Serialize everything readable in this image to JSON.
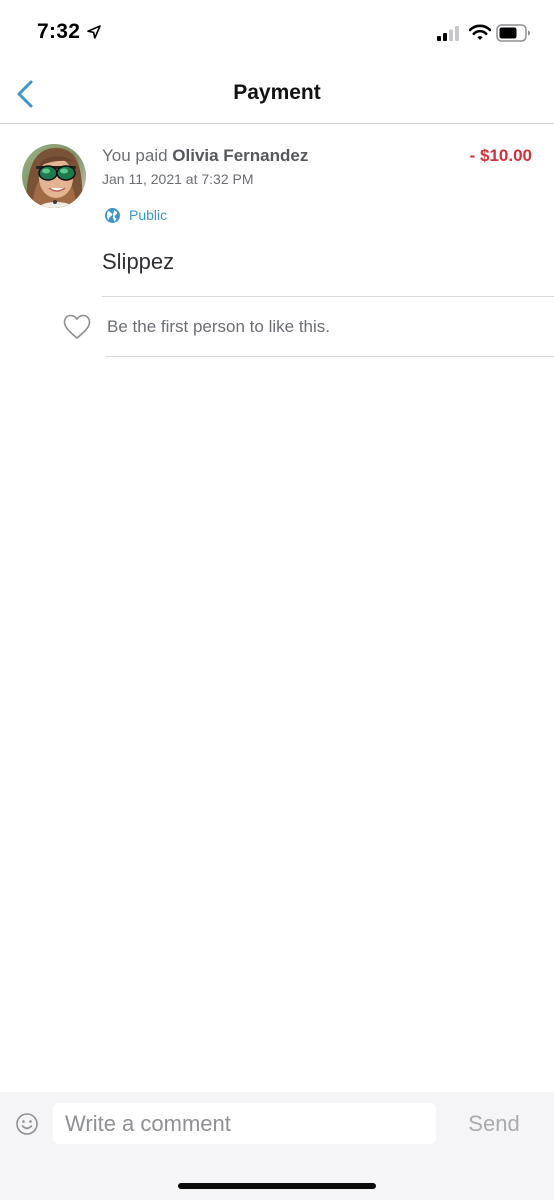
{
  "status_bar": {
    "time": "7:32",
    "icons": [
      "location-arrow-icon",
      "cellular-signal-icon",
      "wifi-icon",
      "battery-icon"
    ]
  },
  "nav": {
    "title": "Payment",
    "back_icon": "chevron-left-icon"
  },
  "story": {
    "headline_prefix": "You paid ",
    "payee": "Olivia Fernandez",
    "amount": "- $10.00",
    "date": "Jan 11, 2021 at 7:32 PM",
    "audience_icon": "globe-icon",
    "audience": "Public",
    "note": "Slippez",
    "like_icon": "heart-outline-icon",
    "like_prompt": "Be the first person to like this."
  },
  "comment_bar": {
    "emoji_icon": "smiley-icon",
    "placeholder": "Write a comment",
    "send_label": "Send"
  },
  "colors": {
    "accent": "#3d95ce",
    "amount_negative": "#d0323b",
    "text_secondary": "#6b6e73",
    "divider": "#d5d7db"
  }
}
